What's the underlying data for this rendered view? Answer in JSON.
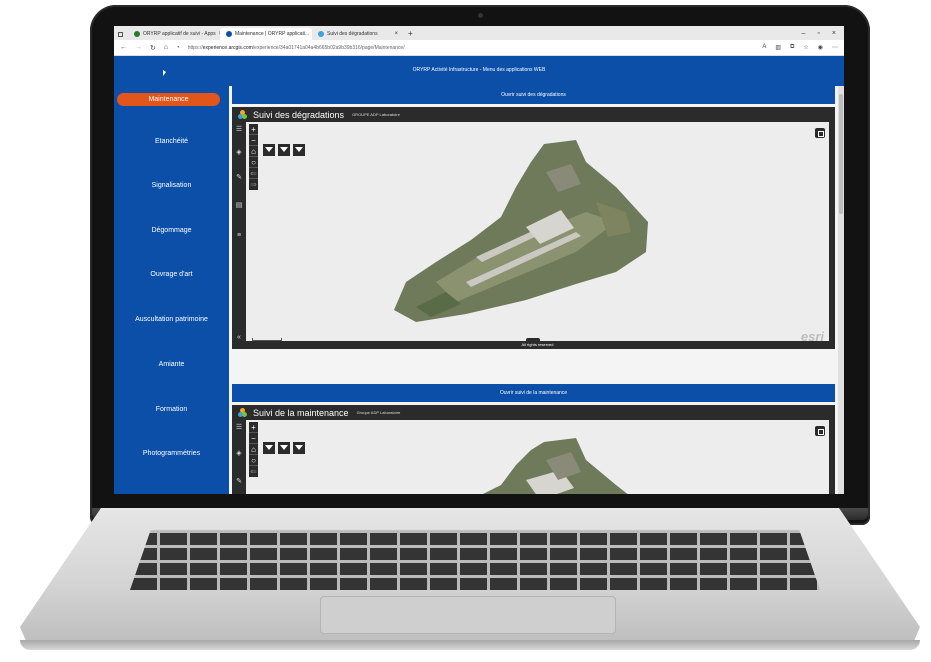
{
  "browser": {
    "tabs": [
      {
        "title": "ORYRP applicatif de suivi - Apps",
        "favicon_color": "#2b7a2b",
        "active": false
      },
      {
        "title": "Maintenance | ORYRP applicati...",
        "favicon_color": "#0b4fa8",
        "active": true
      },
      {
        "title": "Suivi des dégradations",
        "favicon_color": "#3aa0e0",
        "active": false
      }
    ],
    "new_tab": "+",
    "url_prefix": "https://",
    "url_host": "experience.arcgis.com",
    "url_path": "/experience/34a01741a04a4b665b02a9b39b316/page/Maintenance/"
  },
  "header": {
    "title": "ORYRP Activité Infrastructure - Menu des applications WEB"
  },
  "sidebar": {
    "items": [
      {
        "label": "Maintenance",
        "active": true
      },
      {
        "label": "Etanchéité",
        "active": false
      },
      {
        "label": "Signalisation",
        "active": false
      },
      {
        "label": "Dégommage",
        "active": false
      },
      {
        "label": "Ouvrage d'art",
        "active": false
      },
      {
        "label": "Auscultation patrimoine",
        "active": false
      },
      {
        "label": "Amiante",
        "active": false
      },
      {
        "label": "Formation",
        "active": false
      },
      {
        "label": "Photogrammétries",
        "active": false
      }
    ]
  },
  "panels": [
    {
      "open_label": "Ouvrir suivi des dégradations",
      "title": "Suivi des dégradations",
      "org": "GROUPE ADP Laboratoire",
      "attribution": "All rights reserved",
      "logo": "esri"
    },
    {
      "open_label": "Ouvrir suivi de la maintenance",
      "title": "Suivi de la maintenance",
      "org": "Groupe ADP Laboratoire"
    }
  ],
  "map_controls": {
    "zoom_in": "+",
    "zoom_out": "−",
    "home": "⌂",
    "locate": "○",
    "filter_icon": "filter-icon"
  },
  "colors": {
    "accent_blue": "#0b4fa8",
    "active_orange": "#e2561c",
    "panel_dark": "#2b2b2b"
  }
}
